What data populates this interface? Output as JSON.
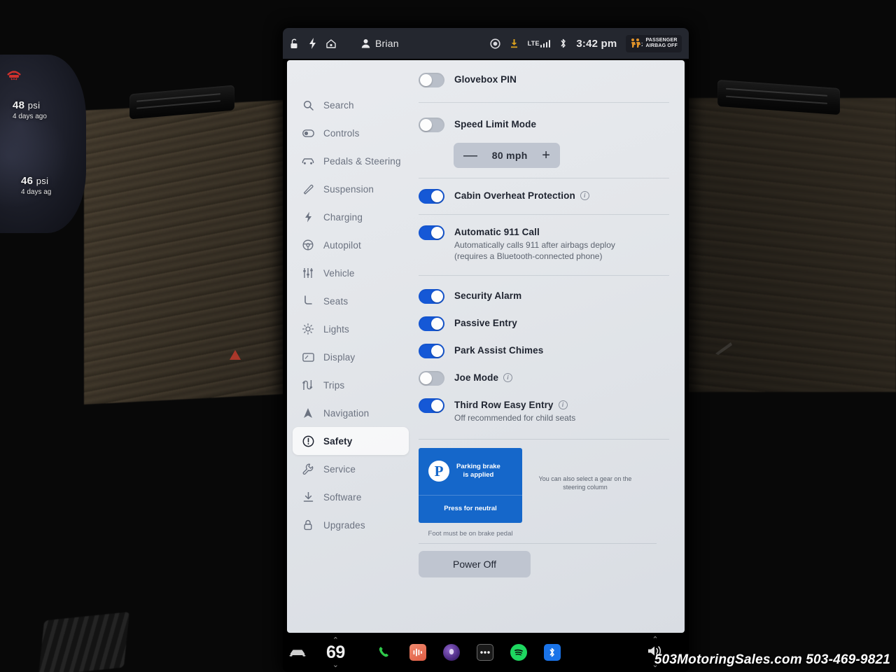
{
  "statusbar": {
    "icons_left": [
      "unlock-icon",
      "bolt-icon",
      "home-icon"
    ],
    "profile_name": "Brian",
    "icons_right": [
      "record-circle-icon",
      "download-icon"
    ],
    "network_label": "LTE",
    "bluetooth_icon": "bluetooth-icon",
    "clock": "3:42 pm",
    "airbag_line1": "PASSENGER",
    "airbag_line2": "AIRBAG OFF"
  },
  "sidebar": {
    "items": [
      {
        "label": "Search",
        "icon": "search-icon",
        "active": false
      },
      {
        "label": "Controls",
        "icon": "toggle-icon",
        "active": false
      },
      {
        "label": "Pedals & Steering",
        "icon": "car-icon",
        "active": false
      },
      {
        "label": "Suspension",
        "icon": "suspension-icon",
        "active": false
      },
      {
        "label": "Charging",
        "icon": "bolt-icon",
        "active": false
      },
      {
        "label": "Autopilot",
        "icon": "steering-icon",
        "active": false
      },
      {
        "label": "Vehicle",
        "icon": "sliders-icon",
        "active": false
      },
      {
        "label": "Seats",
        "icon": "seat-icon",
        "active": false
      },
      {
        "label": "Lights",
        "icon": "sun-icon",
        "active": false
      },
      {
        "label": "Display",
        "icon": "display-icon",
        "active": false
      },
      {
        "label": "Trips",
        "icon": "trips-icon",
        "active": false
      },
      {
        "label": "Navigation",
        "icon": "navigation-icon",
        "active": false
      },
      {
        "label": "Safety",
        "icon": "warning-icon",
        "active": true
      },
      {
        "label": "Service",
        "icon": "wrench-icon",
        "active": false
      },
      {
        "label": "Software",
        "icon": "download-icon",
        "active": false
      },
      {
        "label": "Upgrades",
        "icon": "lock-icon",
        "active": false
      }
    ]
  },
  "settings": {
    "rows": [
      {
        "label": "Glovebox PIN",
        "on": false,
        "info": false,
        "sub": ""
      },
      {
        "label": "Speed Limit Mode",
        "on": false,
        "info": false,
        "sub": ""
      },
      {
        "label": "Cabin Overheat Protection",
        "on": true,
        "info": true,
        "sub": ""
      },
      {
        "label": "Automatic 911 Call",
        "on": true,
        "info": false,
        "sub": "Automatically calls 911 after airbags deploy (requires a Bluetooth-connected phone)"
      },
      {
        "label": "Security Alarm",
        "on": true,
        "info": false,
        "sub": ""
      },
      {
        "label": "Passive Entry",
        "on": true,
        "info": false,
        "sub": ""
      },
      {
        "label": "Park Assist Chimes",
        "on": true,
        "info": false,
        "sub": ""
      },
      {
        "label": "Joe Mode",
        "on": false,
        "info": true,
        "sub": ""
      },
      {
        "label": "Third Row Easy Entry",
        "on": true,
        "info": true,
        "sub": "Off recommended for child seats"
      }
    ],
    "speed_stepper": {
      "minus": "—",
      "value": "80 mph",
      "plus": "+"
    },
    "gear_card": {
      "badge": "P",
      "title_line1": "Parking brake",
      "title_line2": "is applied",
      "action": "Press for neutral",
      "hint": "You can also select a gear on the steering column",
      "footnote": "Foot must be on brake pedal"
    },
    "power_off_label": "Power Off"
  },
  "dock": {
    "car_icon": "car-icon",
    "temperature": "69",
    "chevron_up": "⌃",
    "chevron_down": "⌄",
    "apps": [
      {
        "name": "phone-icon",
        "color": "#2fc84a"
      },
      {
        "name": "media-icon",
        "color": "#ef6a52"
      },
      {
        "name": "browser-icon",
        "color": "#6b3fa0"
      },
      {
        "name": "apps-icon",
        "color": "#2a2a2a"
      },
      {
        "name": "spotify-icon",
        "color": "#1ed760"
      },
      {
        "name": "bluetooth-icon",
        "color": "#1a73e8"
      }
    ],
    "volume_icon": "volume-icon"
  },
  "cluster": {
    "tpms_icon": "tire-pressure-icon",
    "front_psi": "48",
    "front_unit": "psi",
    "front_ago": "4 days ago",
    "rear_psi": "46",
    "rear_unit": "psi",
    "rear_ago": "4 days ag"
  },
  "watermark": "503MotoringSales.com 503-469-9821",
  "colors": {
    "toggle_on": "#1558d6",
    "gear_card": "#1567ca",
    "statusbar_bg": "#24272f",
    "panel_bg": "#e6e9ed"
  }
}
